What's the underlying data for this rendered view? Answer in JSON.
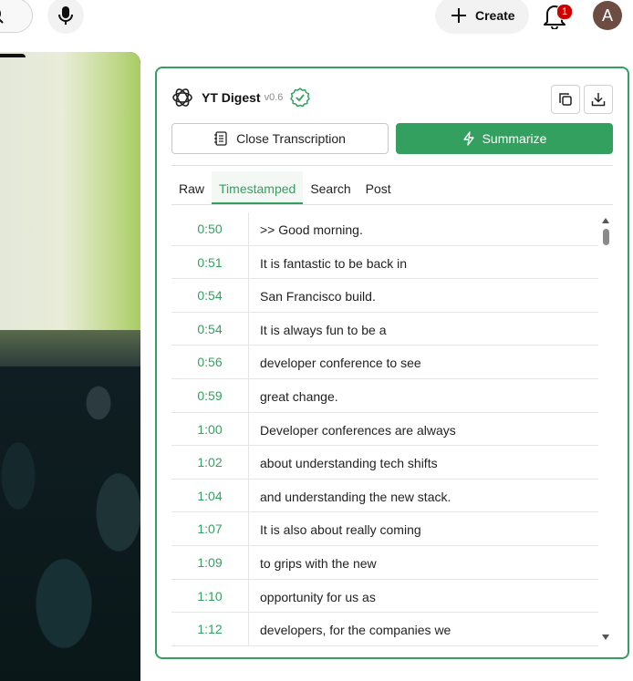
{
  "header": {
    "create_label": "Create",
    "notification_count": "1",
    "avatar_letter": "A"
  },
  "panel": {
    "title": "YT Digest",
    "version": "v0.6",
    "close_label": "Close Transcription",
    "summarize_label": "Summarize",
    "tabs": [
      {
        "label": "Raw"
      },
      {
        "label": "Timestamped"
      },
      {
        "label": "Search"
      },
      {
        "label": "Post"
      }
    ],
    "active_tab": "Timestamped",
    "transcript": [
      {
        "time": "0:50",
        "text": ">> Good morning."
      },
      {
        "time": "0:51",
        "text": "It is fantastic to be back in"
      },
      {
        "time": "0:54",
        "text": "San Francisco build."
      },
      {
        "time": "0:54",
        "text": "It is always fun to be a"
      },
      {
        "time": "0:56",
        "text": "developer conference to see"
      },
      {
        "time": "0:59",
        "text": "great change."
      },
      {
        "time": "1:00",
        "text": "Developer conferences are always"
      },
      {
        "time": "1:02",
        "text": "about understanding tech shifts"
      },
      {
        "time": "1:04",
        "text": "and understanding the new stack."
      },
      {
        "time": "1:07",
        "text": "It is also about really coming"
      },
      {
        "time": "1:09",
        "text": "to grips with the new"
      },
      {
        "time": "1:10",
        "text": "opportunity for us as"
      },
      {
        "time": "1:12",
        "text": "developers, for the companies we"
      }
    ]
  },
  "colors": {
    "accent": "#34a060",
    "badge": "#cc0000",
    "avatar": "#6d4c41"
  },
  "icons": [
    "search-icon",
    "mic-icon",
    "plus-icon",
    "bell-icon",
    "openai-logo-icon",
    "verified-check-icon",
    "copy-icon",
    "download-icon",
    "notebook-icon",
    "lightning-icon",
    "scroll-up-icon",
    "scroll-down-icon"
  ]
}
